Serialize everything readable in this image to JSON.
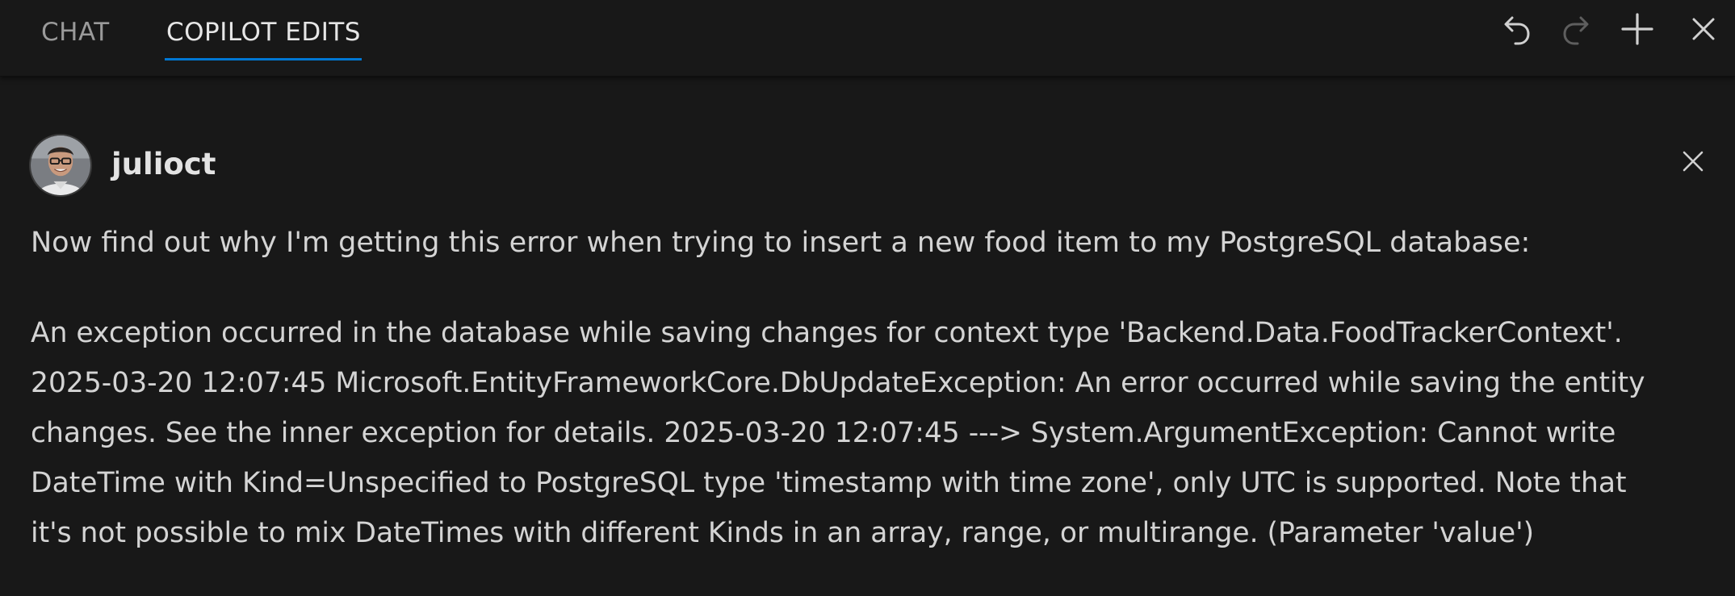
{
  "header": {
    "tabs": [
      {
        "label": "CHAT",
        "active": false
      },
      {
        "label": "COPILOT EDITS",
        "active": true
      }
    ],
    "actions": [
      "undo-icon",
      "redo-icon",
      "plus-icon",
      "close-icon"
    ],
    "accent_color": "#0078d4"
  },
  "message": {
    "username": "julioct",
    "avatar_icon": "user-avatar",
    "prompt": "Now find out why I'm getting this error when trying to insert a new food item to my PostgreSQL database:",
    "error_lines": [
      "An exception occurred in the database while saving changes for context type 'Backend.Data.FoodTrackerContext'.",
      "2025-03-20 12:07:45 Microsoft.EntityFrameworkCore.DbUpdateException: An error occurred while saving the entity",
      "changes. See the inner exception for details. 2025-03-20 12:07:45 ---> System.ArgumentException: Cannot write",
      "DateTime with Kind=Unspecified to PostgreSQL type 'timestamp with time zone', only UTC is supported. Note that",
      "it's not possible to mix DateTimes with different Kinds in an array, range, or multirange. (Parameter 'value')"
    ]
  }
}
